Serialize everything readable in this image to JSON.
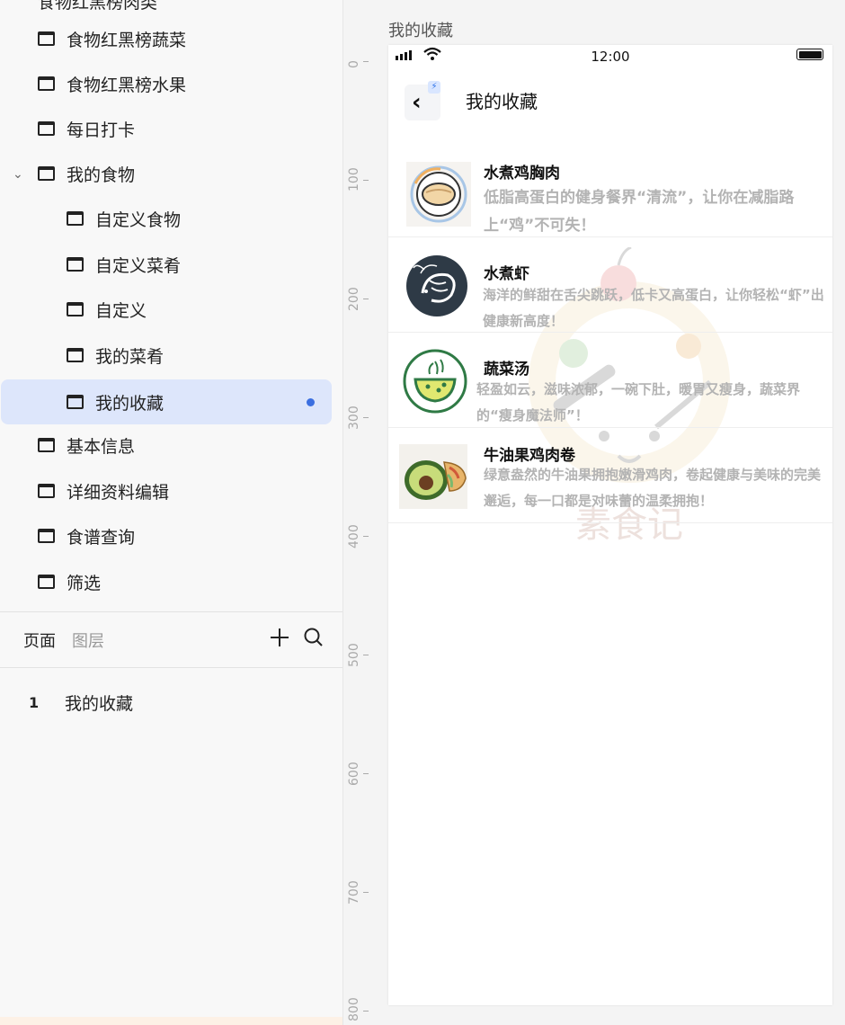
{
  "sidebar": {
    "cut_item_label": "食物红黑榜肉类",
    "pages": [
      {
        "label": "食物红黑榜蔬菜"
      },
      {
        "label": "食物红黑榜水果"
      },
      {
        "label": "每日打卡"
      },
      {
        "label": "我的食物"
      },
      {
        "label": "自定义食物"
      },
      {
        "label": "自定义菜肴"
      },
      {
        "label": "自定义"
      },
      {
        "label": "我的菜肴"
      },
      {
        "label": "我的收藏"
      },
      {
        "label": "基本信息"
      },
      {
        "label": "详细资料编辑"
      },
      {
        "label": "食谱查询"
      },
      {
        "label": "筛选"
      }
    ],
    "tabs": {
      "pages": "页面",
      "layers": "图层"
    },
    "layers": [
      {
        "num": "1",
        "label": "我的收藏"
      }
    ]
  },
  "canvas": {
    "title": "我的收藏",
    "ruler_labels": [
      "0",
      "100",
      "200",
      "300",
      "400",
      "500",
      "600",
      "700",
      "800"
    ]
  },
  "phone": {
    "status_time": "12:00",
    "nav_title": "我的收藏",
    "watermark_text": "素食记",
    "favorites": [
      {
        "name": "水煮鸡胸肉",
        "desc": "低脂高蛋白的健身餐界“清流”，让你在减脂路上“鸡”不可失！"
      },
      {
        "name": "水煮虾",
        "desc": "海洋的鲜甜在舌尖跳跃，低卡又高蛋白，让你轻松“虾”出健康新高度！"
      },
      {
        "name": "蔬菜汤",
        "desc": "轻盈如云，滋味浓郁，一碗下肚，暖胃又瘦身，蔬菜界的“瘦身魔法师”！"
      },
      {
        "name": "牛油果鸡肉卷",
        "desc": "绿意盎然的牛油果拥抱嫩滑鸡肉，卷起健康与美味的完美邂逅，每一口都是对味蕾的温柔拥抱！"
      }
    ]
  },
  "colors": {
    "selected_bg": "#dde6fb",
    "accent_dot": "#3b6fe0",
    "desc_text": "#b3b3b3"
  }
}
